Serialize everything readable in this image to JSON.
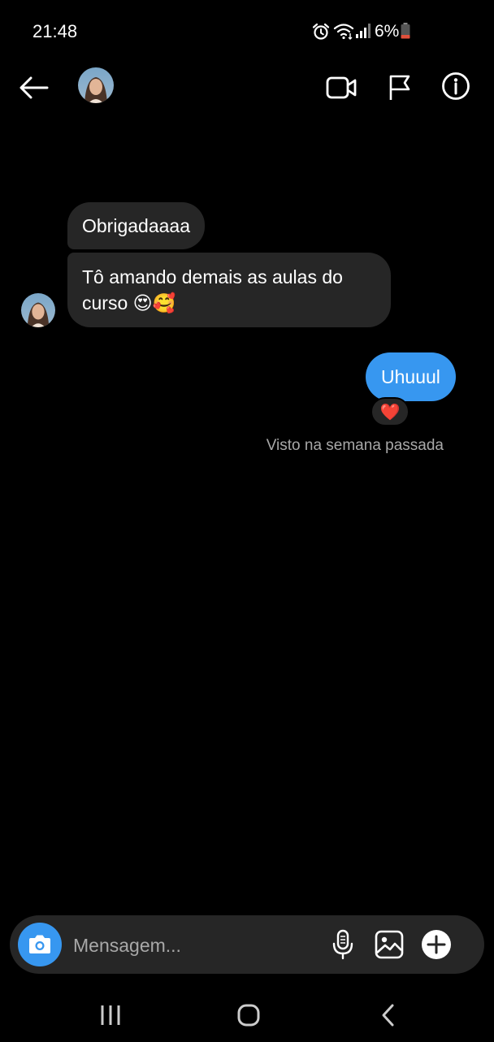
{
  "status_bar": {
    "time": "21:48",
    "battery": "6%",
    "icons": [
      "alarm-icon",
      "wifi-icon",
      "signal-icon",
      "battery-low-icon"
    ]
  },
  "header": {
    "icons": [
      "back-arrow-icon",
      "video-call-icon",
      "flag-icon",
      "info-icon"
    ]
  },
  "messages": [
    {
      "direction": "incoming",
      "text": "Obrigadaaaa"
    },
    {
      "direction": "incoming",
      "text": "Tô amando demais as aulas do curso 😍🥰"
    },
    {
      "direction": "outgoing",
      "text": "Uhuuul",
      "reaction": "❤️"
    }
  ],
  "seen_status": "Visto na semana passada",
  "composer": {
    "placeholder": "Mensagem...",
    "icons": [
      "camera-icon",
      "microphone-icon",
      "gallery-icon",
      "plus-icon"
    ]
  },
  "nav_bar": {
    "icons": [
      "recent-apps-icon",
      "home-icon",
      "back-icon"
    ]
  },
  "colors": {
    "background": "#000000",
    "incoming_bubble": "#262626",
    "outgoing_bubble": "#3797f0",
    "secondary_text": "#a8a8a8",
    "battery_low": "#e0503c"
  }
}
